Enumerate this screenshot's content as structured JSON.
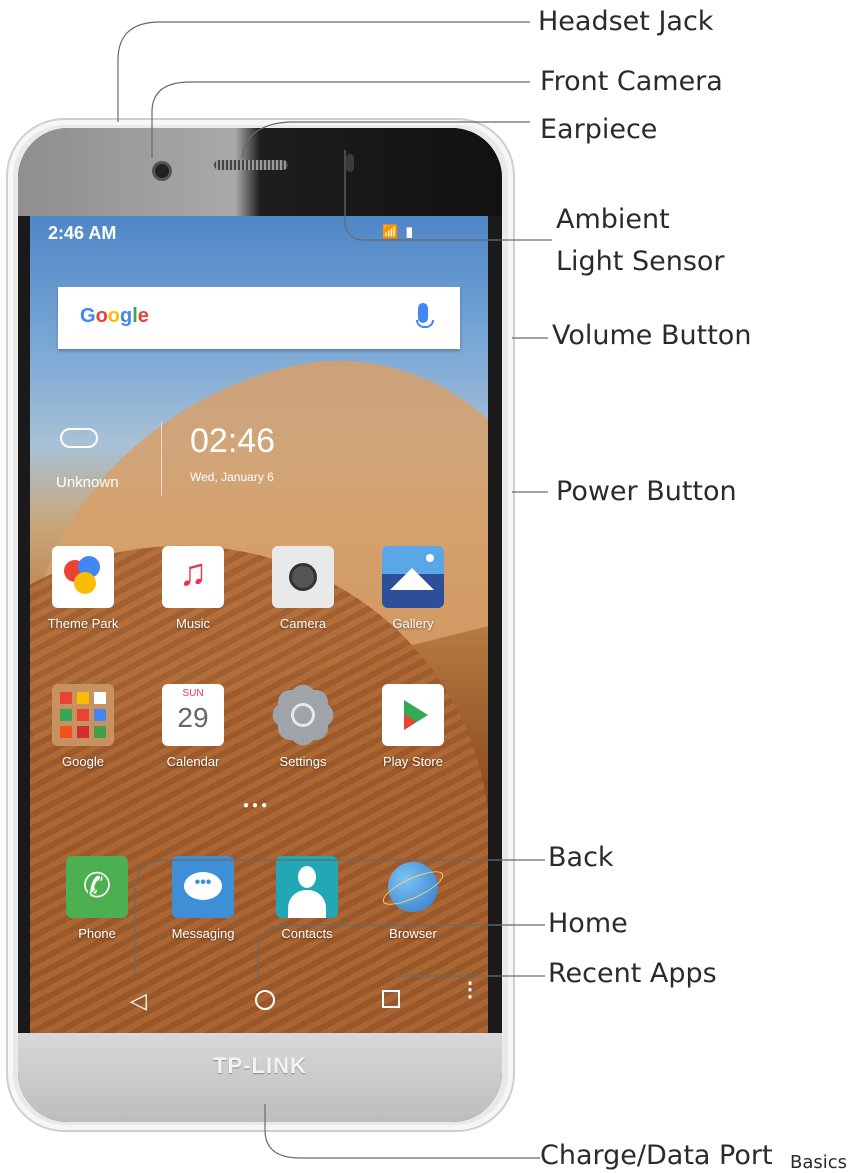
{
  "callouts": {
    "headset_jack": "Headset Jack",
    "front_camera": "Front Camera",
    "earpiece": "Earpiece",
    "ambient_light_sensor_line1": "Ambient",
    "ambient_light_sensor_line2": "Light Sensor",
    "volume_button": "Volume Button",
    "power_button": "Power Button",
    "back": "Back",
    "home": "Home",
    "recent_apps": "Recent Apps",
    "charge_data_port": "Charge/Data Port"
  },
  "footer": {
    "section": "Basics"
  },
  "phone": {
    "brand": "TP-LINK",
    "status_bar": {
      "time": "2:46 AM",
      "icons": "📶 ▮"
    },
    "search": {
      "logo": "Google"
    },
    "weather": {
      "label": "Unknown",
      "icon": "cloud-icon"
    },
    "clock": {
      "time": "02:46",
      "date": "Wed, January 6"
    },
    "apps_row1": [
      {
        "label": "Theme Park",
        "icon": "theme-park-icon",
        "color": "#ffffff"
      },
      {
        "label": "Music",
        "icon": "music-icon",
        "color": "#ffffff"
      },
      {
        "label": "Camera",
        "icon": "camera-icon",
        "color": "#e9e9e9"
      },
      {
        "label": "Gallery",
        "icon": "gallery-icon",
        "color": "#2d4f9a"
      }
    ],
    "apps_row2": [
      {
        "label": "Google",
        "icon": "google-folder-icon",
        "color": "#c89160"
      },
      {
        "label": "Calendar",
        "icon": "calendar-icon",
        "color": "#ffffff",
        "day": "SUN",
        "date": "29"
      },
      {
        "label": "Settings",
        "icon": "settings-icon",
        "color": "#9fa4a8"
      },
      {
        "label": "Play Store",
        "icon": "play-store-icon",
        "color": "#ffffff"
      }
    ],
    "dock": [
      {
        "label": "Phone",
        "icon": "phone-icon",
        "color": "#4caf50"
      },
      {
        "label": "Messaging",
        "icon": "messaging-icon",
        "color": "#3f8fd6"
      },
      {
        "label": "Contacts",
        "icon": "contacts-icon",
        "color": "#22a7b5"
      },
      {
        "label": "Browser",
        "icon": "browser-icon",
        "color": "#3a8fd8"
      }
    ],
    "nav": {
      "back": "◁",
      "menu": "⋮"
    }
  }
}
